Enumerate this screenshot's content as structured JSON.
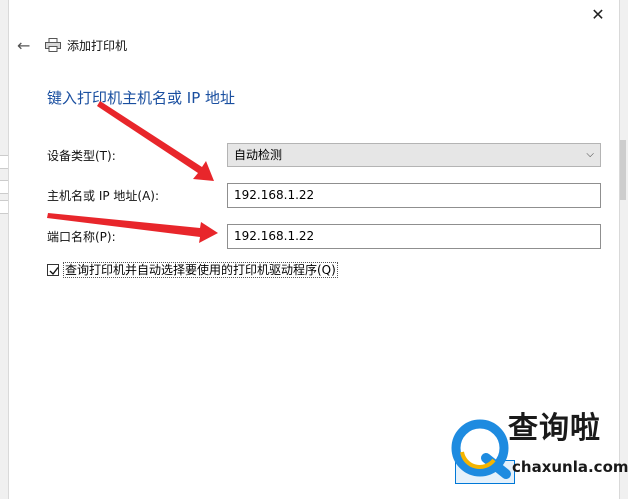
{
  "header": {
    "title": "添加打印机"
  },
  "heading": "键入打印机主机名或 IP 地址",
  "form": {
    "device_type_label": "设备类型(T):",
    "device_type_value": "自动检测",
    "host_label": "主机名或 IP 地址(A):",
    "host_value": "192.168.1.22",
    "port_label": "端口名称(P):",
    "port_value": "192.168.1.22",
    "query_checkbox_label": "查询打印机并自动选择要使用的打印机驱动程序(Q)",
    "query_checked": true
  },
  "watermark": {
    "text": "查询啦",
    "domain": "chaxunla.com"
  },
  "colors": {
    "heading": "#1a4fa0",
    "arrow": "#e8262b",
    "watermark_blue": "#1e8be0"
  },
  "icons": [
    "back-arrow-icon",
    "printer-icon",
    "close-icon",
    "chevron-down-icon",
    "check-icon",
    "magnifier-logo-icon"
  ]
}
